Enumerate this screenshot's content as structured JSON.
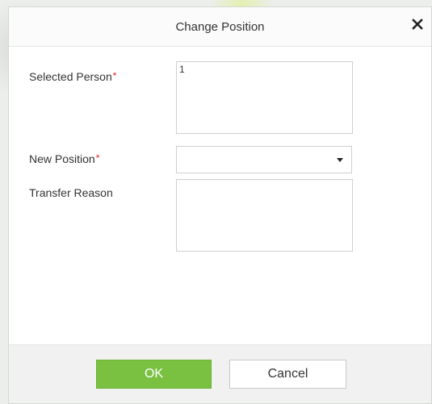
{
  "dialog": {
    "title": "Change Position",
    "close_icon": "close-icon"
  },
  "form": {
    "selected_person": {
      "label": "Selected Person",
      "required_mark": "*",
      "value": "1"
    },
    "new_position": {
      "label": "New Position",
      "required_mark": "*",
      "value": "",
      "dropdown_icon": "chevron-down-icon"
    },
    "transfer_reason": {
      "label": "Transfer Reason",
      "value": ""
    }
  },
  "footer": {
    "ok_label": "OK",
    "cancel_label": "Cancel"
  },
  "colors": {
    "ok_button": "#7ac142",
    "required_mark": "#e02020"
  }
}
